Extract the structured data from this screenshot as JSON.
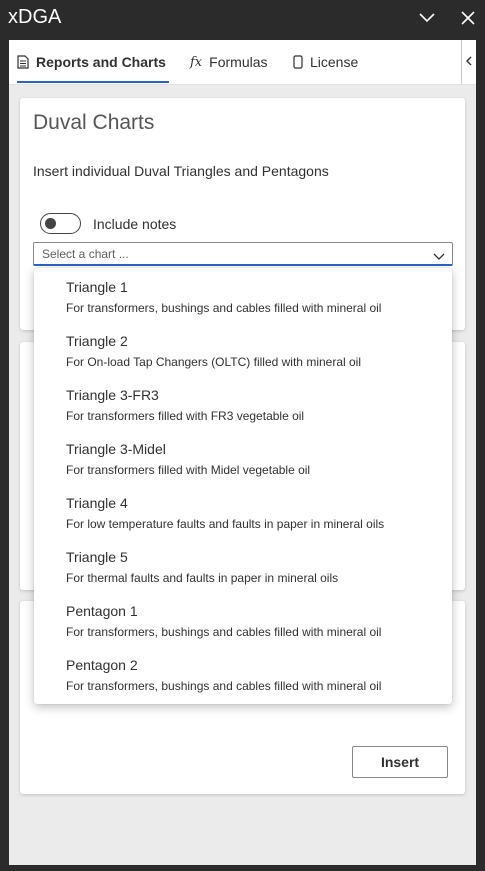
{
  "window": {
    "title": "xDGA"
  },
  "tabs": [
    {
      "label": "Reports and Charts",
      "icon": "document-icon",
      "active": true
    },
    {
      "label": "Formulas",
      "icon": "fx-icon",
      "glyph": "fx",
      "active": false
    },
    {
      "label": "License",
      "icon": "page-icon",
      "active": false
    }
  ],
  "duval_card": {
    "title": "Duval Charts",
    "description": "Insert individual Duval Triangles and Pentagons",
    "toggle_label": "Include notes",
    "toggle_on": false,
    "select_placeholder": "Select a chart ..."
  },
  "dropdown": {
    "options": [
      {
        "title": "Triangle 1",
        "description": "For transformers, bushings and cables filled with mineral oil"
      },
      {
        "title": "Triangle 2",
        "description": "For On-load Tap Changers (OLTC) filled with mineral oil"
      },
      {
        "title": "Triangle 3-FR3",
        "description": "For transformers filled with FR3 vegetable oil"
      },
      {
        "title": "Triangle 3-Midel",
        "description": "For transformers filled with Midel vegetable oil"
      },
      {
        "title": "Triangle 4",
        "description": "For low temperature faults and faults in paper in mineral oils"
      },
      {
        "title": "Triangle 5",
        "description": "For thermal faults and faults in paper in mineral oils"
      },
      {
        "title": "Pentagon 1",
        "description": "For transformers, bushings and cables filled with mineral oil"
      },
      {
        "title": "Pentagon 2",
        "description": "For transformers, bushings and cables filled with mineral oil"
      }
    ]
  },
  "bottom_card": {
    "insert_label": "Insert"
  },
  "colors": {
    "accent": "#2a63c4",
    "titlebar": "#2b2b2b",
    "pane_background": "#ebebeb"
  }
}
